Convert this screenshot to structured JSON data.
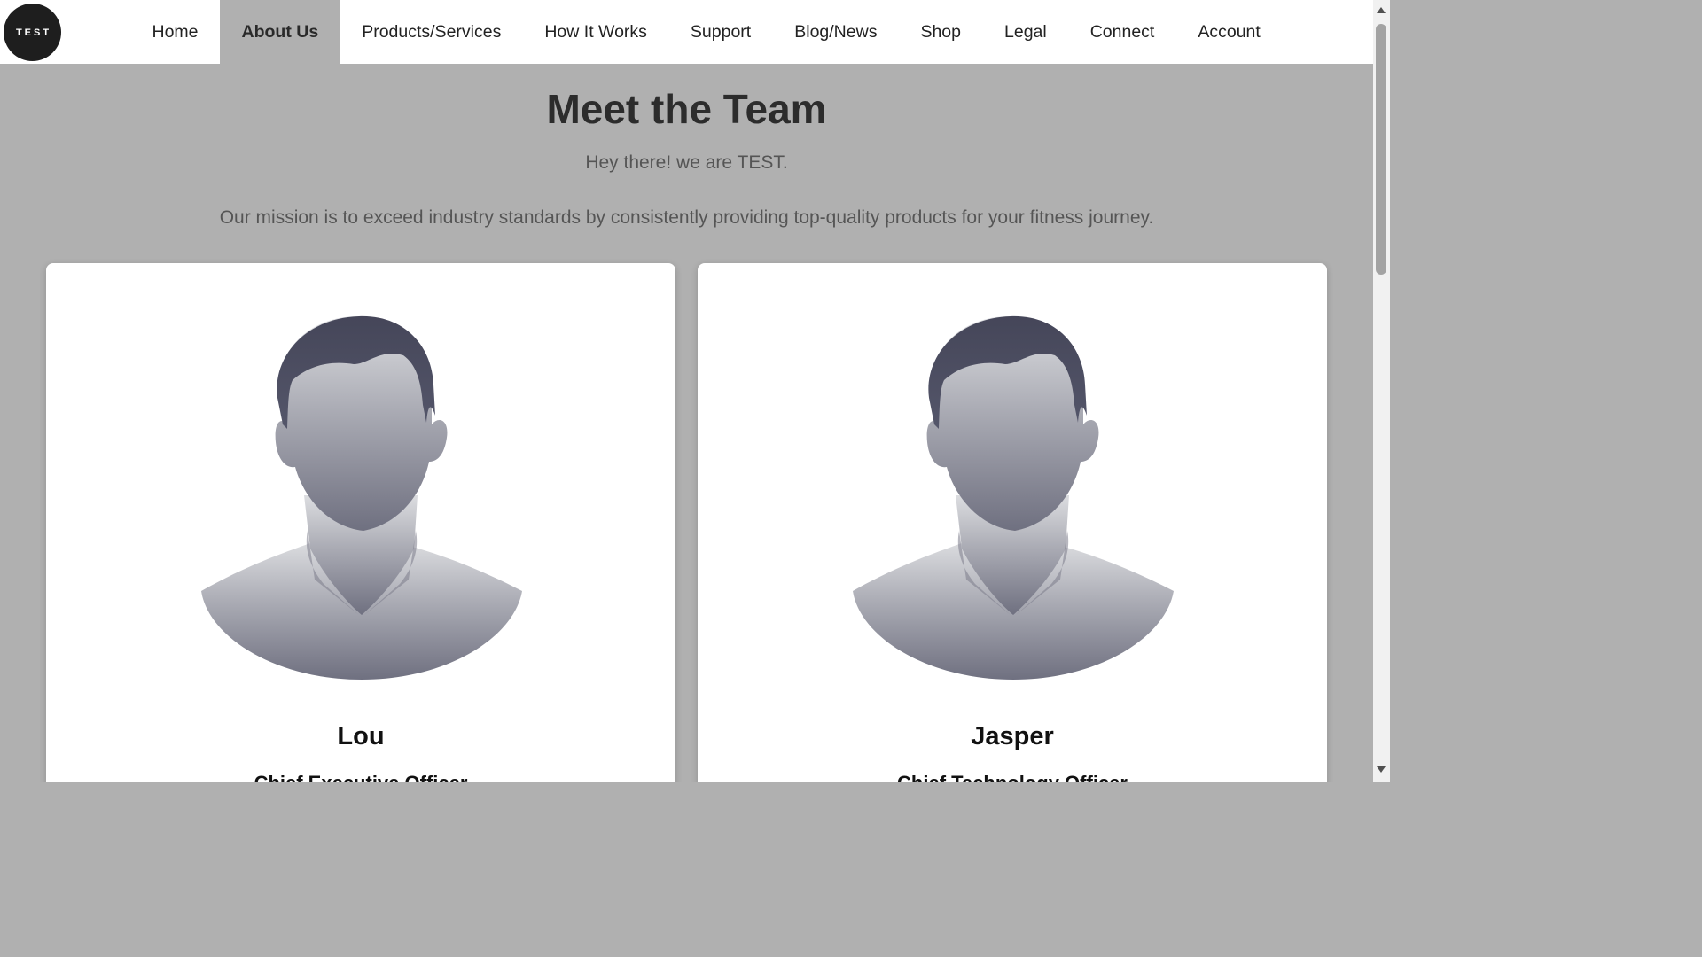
{
  "logo": {
    "text": "TEST"
  },
  "nav": {
    "items": [
      {
        "label": "Home",
        "active": false
      },
      {
        "label": "About Us",
        "active": true
      },
      {
        "label": "Products/Services",
        "active": false
      },
      {
        "label": "How It Works",
        "active": false
      },
      {
        "label": "Support",
        "active": false
      },
      {
        "label": "Blog/News",
        "active": false
      },
      {
        "label": "Shop",
        "active": false
      },
      {
        "label": "Legal",
        "active": false
      },
      {
        "label": "Connect",
        "active": false
      },
      {
        "label": "Account",
        "active": false
      }
    ]
  },
  "main": {
    "title": "Meet the Team",
    "subtitle": "Hey there! we are TEST.",
    "mission": "Our mission is to exceed industry standards by consistently providing top-quality products for your fitness journey."
  },
  "team": [
    {
      "name": "Lou",
      "role": "Chief Executive Officer",
      "avatar_icon": "person-silhouette-icon"
    },
    {
      "name": "Jasper",
      "role": "Chief Technology Officer",
      "avatar_icon": "person-silhouette-icon"
    }
  ],
  "colors": {
    "page_background": "#b0b0b0",
    "nav_background": "#ffffff",
    "active_tab": "#b0b0b0",
    "logo_background": "#1e1e1e",
    "card_background": "#ffffff"
  }
}
